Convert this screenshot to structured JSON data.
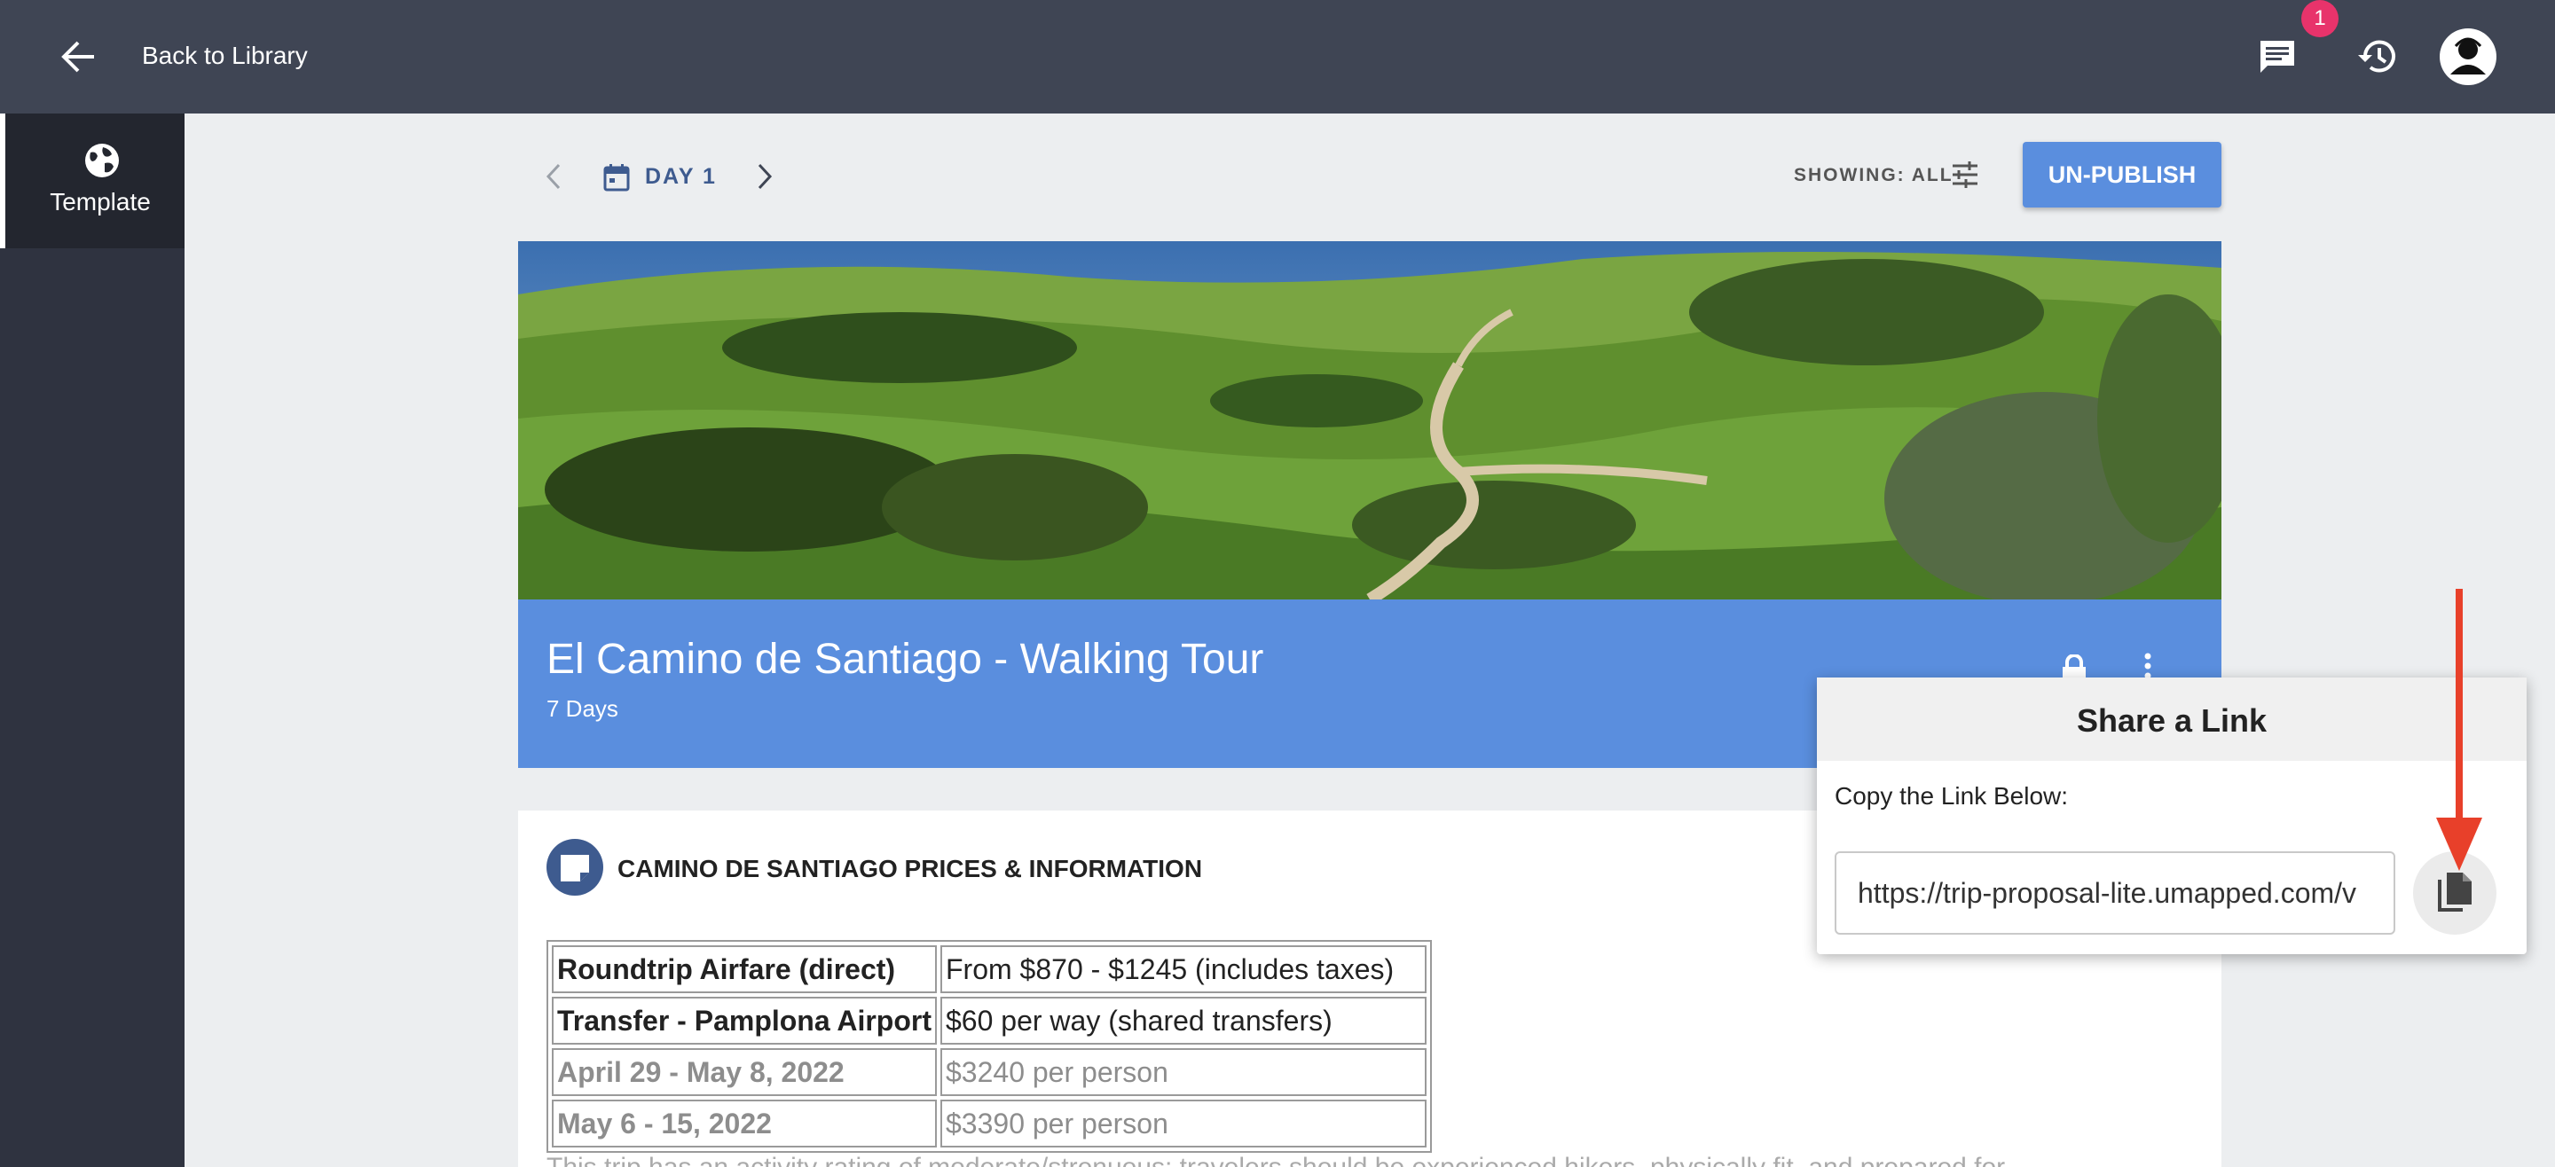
{
  "header": {
    "back_label": "Back to Library",
    "notification_count": "1",
    "icons": [
      "back-arrow-icon",
      "chat-icon",
      "history-icon",
      "avatar"
    ]
  },
  "sidebar": {
    "items": [
      {
        "label": "Template",
        "icon": "globe-icon",
        "active": true
      }
    ]
  },
  "toolbar": {
    "day_label": "DAY 1",
    "showing_label": "SHOWING: ALL",
    "unpublish_label": "UN-PUBLISH"
  },
  "trip": {
    "title": "El Camino de Santiago - Walking Tour",
    "duration": "7 Days"
  },
  "card": {
    "title": "CAMINO DE SANTIAGO PRICES & INFORMATION",
    "rows": [
      [
        "Roundtrip Airfare (direct)",
        "From $870 - $1245 (includes taxes)"
      ],
      [
        "Transfer - Pamplona Airport",
        "$60 per way (shared transfers)"
      ],
      [
        "April 29 - May 8, 2022",
        "$3240 per person"
      ],
      [
        "May 6 - 15, 2022",
        "$3390 per person"
      ]
    ],
    "description": "This trip has an activity rating of moderate/strenuous; travelers should be experienced hikers, physically fit, and prepared for"
  },
  "share_popup": {
    "title": "Share a Link",
    "subtitle": "Copy the Link Below:",
    "link_value": "https://trip-proposal-lite.umapped.com/v"
  },
  "colors": {
    "topbar": "#3f4554",
    "sidebar": "#2f3340",
    "accent": "#5a8ede",
    "badge": "#e8336b",
    "annotation": "#e8402a"
  }
}
